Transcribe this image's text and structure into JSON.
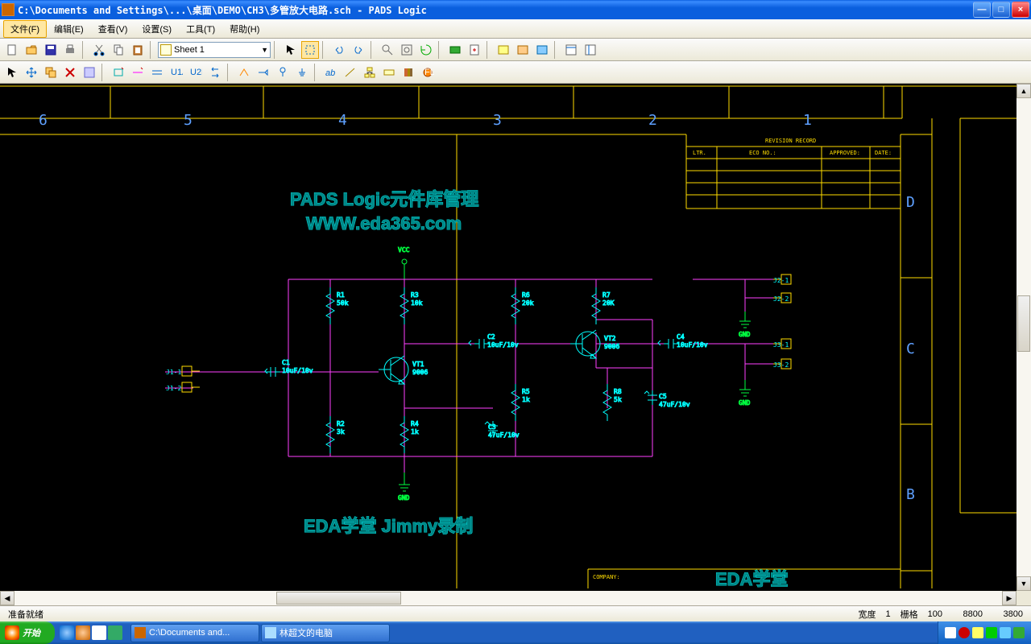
{
  "title": "C:\\Documents and Settings\\...\\桌面\\DEMO\\CH3\\多管放大电路.sch - PADS Logic",
  "menu": {
    "file": "文件(F)",
    "edit": "编辑(E)",
    "view": "查看(V)",
    "setup": "设置(S)",
    "tool": "工具(T)",
    "help": "帮助(H)"
  },
  "sheet_selector": "Sheet 1",
  "status": {
    "ready": "准备就绪",
    "width": "宽度",
    "w": "1",
    "grid": "栅格",
    "g": "100",
    "x": "8800",
    "y": "3800"
  },
  "taskbar": {
    "start": "开始",
    "t1": "C:\\Documents and...",
    "t2": "林超文的电脑"
  },
  "schematic": {
    "cols": [
      "6",
      "5",
      "4",
      "3",
      "2",
      "1"
    ],
    "rows": [
      "D",
      "C",
      "B"
    ],
    "rev_hdr": "REVISION RECORD",
    "rev_cols": [
      "LTR.",
      "ECO NO.:",
      "APPROVED:",
      "DATE:"
    ],
    "watermark1": "PADS Logic元件库管理",
    "watermark2": "WWW.eda365.com",
    "watermark3": "EDA学堂 Jimmy录制",
    "company_lbl": "COMPANY:",
    "company": "EDA学堂",
    "vcc": "VCC",
    "gnd": "GND",
    "parts": {
      "r1": {
        "ref": "R1",
        "val": "50k"
      },
      "r2": {
        "ref": "R2",
        "val": "3k"
      },
      "r3": {
        "ref": "R3",
        "val": "10k"
      },
      "r4": {
        "ref": "R4",
        "val": "1k"
      },
      "r5": {
        "ref": "R5",
        "val": "1k"
      },
      "r6": {
        "ref": "R6",
        "val": "20k"
      },
      "r7": {
        "ref": "R7",
        "val": "20K"
      },
      "r8": {
        "ref": "R8",
        "val": "5k"
      },
      "c1": {
        "ref": "C1",
        "val": "10uF/10v"
      },
      "c2": {
        "ref": "C2",
        "val": "10uF/10v"
      },
      "c3": {
        "ref": "C3",
        "val": "47uF/10v"
      },
      "c4": {
        "ref": "C4",
        "val": "10uF/10v"
      },
      "c5": {
        "ref": "C5",
        "val": "47uF/10v"
      },
      "vt1": {
        "ref": "VT1",
        "val": "9006"
      },
      "vt2": {
        "ref": "VT2",
        "val": "9006"
      },
      "j1a": "J1-1",
      "j1b": "J1-2",
      "j2a": "J2-1",
      "j2b": "J2-2",
      "j3a": "J3-1",
      "j3b": "J3-2"
    }
  }
}
